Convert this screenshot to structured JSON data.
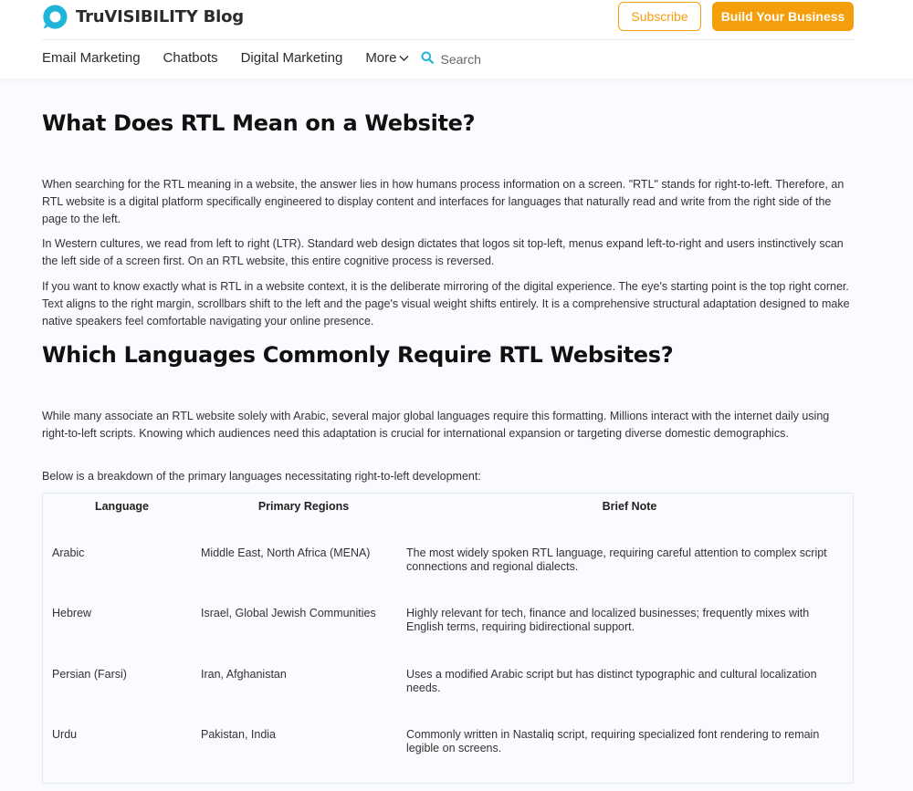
{
  "header": {
    "brand": "TruVISIBILITY Blog",
    "subscribe_label": "Subscribe",
    "build_label": "Build Your Business",
    "accent_color": "#f59e0b",
    "logo_color": "#1fb5d8",
    "logo_icon": "speech-bubble-icon"
  },
  "nav": {
    "items": [
      "Email Marketing",
      "Chatbots",
      "Digital Marketing"
    ],
    "more_label": "More",
    "more_icon": "chevron-down-icon",
    "search_icon": "search-icon",
    "search_placeholder": "Search"
  },
  "article": {
    "section1": {
      "heading": "What Does RTL Mean on a Website?",
      "paragraphs": [
        "When searching for the RTL meaning in a website, the answer lies in how humans process information on a screen. \"RTL\" stands for right-to-left. Therefore, an RTL website is a digital platform specifically engineered to display content and interfaces for languages that naturally read and write from the right side of the page to the left.",
        "In Western cultures, we read from left to right (LTR). Standard web design dictates that logos sit top-left, menus expand left-to-right and users instinctively scan the left side of a screen first. On an RTL website, this entire cognitive process is reversed.",
        "If you want to know exactly what is RTL in a website context, it is the deliberate mirroring of the digital experience. The eye's starting point is the top right corner. Text aligns to the right margin, scrollbars shift to the left and the page's visual weight shifts entirely. It is a comprehensive structural adaptation designed to make native speakers feel comfortable navigating your online presence."
      ]
    },
    "section2": {
      "heading": "Which Languages Commonly Require RTL Websites?",
      "paragraphs": [
        "While many associate an RTL website solely with Arabic, several major global languages require this formatting. Millions interact with the internet daily using right-to-left scripts. Knowing which audiences need this adaptation is crucial for international expansion or targeting diverse domestic demographics.",
        "Below is a breakdown of the primary languages necessitating right-to-left development:"
      ]
    },
    "table": {
      "headers": [
        "Language",
        "Primary Regions",
        "Brief Note"
      ],
      "rows": [
        [
          "Arabic",
          "Middle East, North Africa (MENA)",
          "The most widely spoken RTL language, requiring careful attention to complex script connections and regional dialects."
        ],
        [
          "Hebrew",
          "Israel, Global Jewish Communities",
          "Highly relevant for tech, finance and localized businesses; frequently mixes with English terms, requiring bidirectional support."
        ],
        [
          "Persian (Farsi)",
          "Iran, Afghanistan",
          "Uses a modified Arabic script but has distinct typographic and cultural localization needs."
        ],
        [
          "Urdu",
          "Pakistan, India",
          "Commonly written in Nastaliq script, requiring specialized font rendering to remain legible on screens."
        ]
      ]
    }
  }
}
